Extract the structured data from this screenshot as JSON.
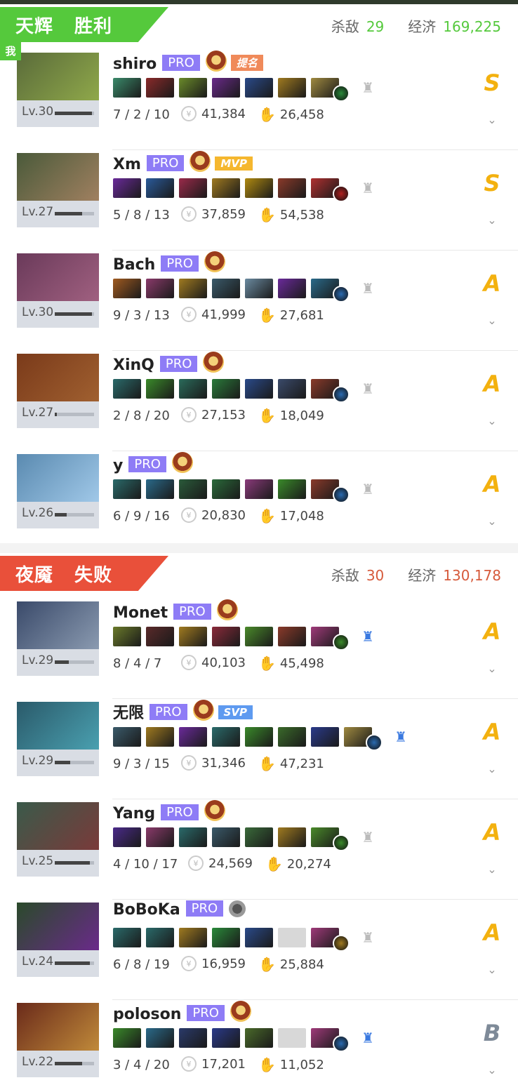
{
  "colors": {
    "radiant": "#55c93c",
    "dire": "#e9503a",
    "radiant_value": "#55c93c",
    "dire_value": "#d65a3b",
    "pro_badge": "#8e7cf6",
    "grade_gold": "#f3b10f",
    "grade_gray": "#7e8a98"
  },
  "radiant": {
    "name": "天辉",
    "result": "胜利",
    "kills_label": "杀敌",
    "kills": "29",
    "econ_label": "经济",
    "econ": "169,225",
    "me_badge": "我",
    "players": [
      {
        "name": "shiro",
        "pro": "PRO",
        "tag": "提名",
        "level": "Lv.30",
        "xp": 0.95,
        "kda": "7 / 2 / 10",
        "gold": "41,384",
        "damage": "26,458",
        "grade": "S",
        "hero_colors": [
          "#5a6b3a",
          "#8fa84a"
        ],
        "items": [
          "#3a8a6a",
          "#8a2a2a",
          "#6a8a2a",
          "#6a2a8a",
          "#2a4a8a",
          "#a07a20",
          "#a08a40"
        ],
        "neutral": "#2a8a3a",
        "scepter": false
      },
      {
        "name": "Xm",
        "pro": "PRO",
        "tag": "MVP",
        "level": "Lv.27",
        "xp": 0.7,
        "kda": "5 / 8 / 13",
        "gold": "37,859",
        "damage": "54,538",
        "grade": "S",
        "hero_colors": [
          "#4a5a3a",
          "#a08060"
        ],
        "items": [
          "#6a2a9a",
          "#2a5a9a",
          "#9a2a4a",
          "#a07a20",
          "#b08a10",
          "#8a3a2a",
          "#b03030"
        ],
        "neutral": "#b02020",
        "scepter": false
      },
      {
        "name": "Bach",
        "pro": "PRO",
        "tag": "",
        "level": "Lv.30",
        "xp": 0.95,
        "kda": "9 / 3 / 13",
        "gold": "41,999",
        "damage": "27,681",
        "grade": "A",
        "hero_colors": [
          "#6a3a5a",
          "#a06080"
        ],
        "items": [
          "#a05a20",
          "#8a3a6a",
          "#a07a20",
          "#3a5a6a",
          "#6a8aa0",
          "#6a2a9a",
          "#2a6a8a"
        ],
        "neutral": "#2a6ab0",
        "scepter": false
      },
      {
        "name": "XinQ",
        "pro": "PRO",
        "tag": "",
        "level": "Lv.27",
        "xp": 0.05,
        "kda": "2 / 8 / 20",
        "gold": "27,153",
        "damage": "18,049",
        "grade": "A",
        "hero_colors": [
          "#7a3a1a",
          "#a06030"
        ],
        "items": [
          "#2a6a6a",
          "#3a8a2a",
          "#2a6a5a",
          "#2a7a3a",
          "#2a4a8a",
          "#3a4a6a",
          "#8a3a2a"
        ],
        "neutral": "#2a6ab0",
        "scepter": false
      },
      {
        "name": "y",
        "pro": "PRO",
        "tag": "",
        "level": "Lv.26",
        "xp": 0.3,
        "kda": "6 / 9 / 16",
        "gold": "20,830",
        "damage": "17,048",
        "grade": "A",
        "hero_colors": [
          "#5a8ab0",
          "#a0c8e8"
        ],
        "items": [
          "#2a6a6a",
          "#2a6a8a",
          "#2a5a3a",
          "#2a6a3a",
          "#8a3a7a",
          "#3a8a2a",
          "#8a3a2a"
        ],
        "neutral": "#2a6ab0",
        "scepter": false
      }
    ]
  },
  "dire": {
    "name": "夜魇",
    "result": "失败",
    "kills_label": "杀敌",
    "kills": "30",
    "econ_label": "经济",
    "econ": "130,178",
    "players": [
      {
        "name": "Monet",
        "pro": "PRO",
        "tag": "",
        "level": "Lv.29",
        "xp": 0.35,
        "kda": "8 / 4 / 7",
        "gold": "40,103",
        "damage": "45,498",
        "grade": "A",
        "hero_colors": [
          "#3a4a6a",
          "#8a9ab0"
        ],
        "items": [
          "#6a7a2a",
          "#5a2a2a",
          "#a07a20",
          "#8a2a3a",
          "#4a8a2a",
          "#8a3a2a",
          "#a03a7a"
        ],
        "neutral": "#3a8a2a",
        "scepter": true
      },
      {
        "name": "无限",
        "pro": "PRO",
        "tag": "SVP",
        "level": "Lv.29",
        "xp": 0.4,
        "kda": "9 / 3 / 15",
        "gold": "31,346",
        "damage": "47,231",
        "grade": "A",
        "hero_colors": [
          "#2a5a6a",
          "#4aa0b0"
        ],
        "items": [
          "#3a5a6a",
          "#a07a20",
          "#6a2a9a",
          "#2a6a6a",
          "#3a8a2a",
          "#3a6a2a",
          "#2a3a8a",
          "#a08a40"
        ],
        "neutral": "#2a6ab0",
        "scepter": true
      },
      {
        "name": "Yang",
        "pro": "PRO",
        "tag": "",
        "level": "Lv.25",
        "xp": 0.9,
        "kda": "4 / 10 / 17",
        "gold": "24,569",
        "damage": "20,274",
        "grade": "A",
        "hero_colors": [
          "#3a5a4a",
          "#7a3a3a"
        ],
        "items": [
          "#4a2a8a",
          "#8a3a6a",
          "#2a6a6a",
          "#3a5a6a",
          "#3a6a3a",
          "#a07a20",
          "#4a8a2a"
        ],
        "neutral": "#3a8a2a",
        "scepter": false
      },
      {
        "name": "BoBoKa",
        "pro": "PRO",
        "tag": "",
        "level": "Lv.24",
        "xp": 0.9,
        "kda": "6 / 8 / 19",
        "gold": "16,959",
        "damage": "25,884",
        "grade": "A",
        "hero_colors": [
          "#2a4a2a",
          "#6a2a8a"
        ],
        "items": [
          "#2a6a6a",
          "#2a6a6a",
          "#a07a20",
          "#2a8a3a",
          "#2a4a8a",
          "",
          "#a03a7a"
        ],
        "neutral": "#a07a20",
        "scepter": false
      },
      {
        "name": "poloson",
        "pro": "PRO",
        "tag": "",
        "level": "Lv.22",
        "xp": 0.7,
        "kda": "3 / 4 / 20",
        "gold": "17,201",
        "damage": "11,052",
        "grade": "B",
        "hero_colors": [
          "#6a2a1a",
          "#c08a3a"
        ],
        "items": [
          "#3a8a2a",
          "#2a6a8a",
          "#2a3a6a",
          "#2a3a8a",
          "#4a6a2a",
          "",
          "#a03a7a"
        ],
        "neutral": "#2a6ab0",
        "scepter": true
      }
    ]
  }
}
